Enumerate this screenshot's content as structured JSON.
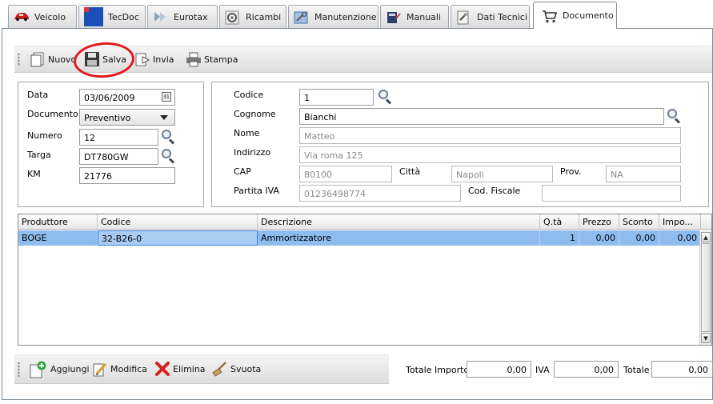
{
  "tabs": [
    {
      "label": "Veicolo",
      "icon": "car-icon"
    },
    {
      "label": "TecDoc",
      "icon": "tecdoc-logo-icon"
    },
    {
      "label": "Eurotax",
      "icon": "eurotax-icon"
    },
    {
      "label": "Ricambi",
      "icon": "spare-parts-icon"
    },
    {
      "label": "Manutenzione",
      "icon": "maintenance-icon"
    },
    {
      "label": "Manuali",
      "icon": "manual-book-icon"
    },
    {
      "label": "Dati Tecnici",
      "icon": "technical-data-icon"
    },
    {
      "label": "Documento",
      "icon": "shopping-cart-icon",
      "active": true
    }
  ],
  "toolbar": {
    "new_label": "Nuovo",
    "save_label": "Salva",
    "send_label": "Invia",
    "print_label": "Stampa"
  },
  "document": {
    "date_label": "Data",
    "date_value": "03/06/2009",
    "doc_label": "Documento",
    "doc_value": "Preventivo",
    "number_label": "Numero",
    "number_value": "12",
    "plate_label": "Targa",
    "plate_value": "DT780GW",
    "km_label": "KM",
    "km_value": "21776"
  },
  "customer": {
    "code_label": "Codice",
    "code_value": "1",
    "surname_label": "Cognome",
    "surname_value": "Bianchi",
    "name_label": "Nome",
    "name_value": "Matteo",
    "address_label": "Indirizzo",
    "address_value": "Via roma 125",
    "cap_label": "CAP",
    "cap_value": "80100",
    "city_label": "Città",
    "city_value": "Napoli",
    "prov_label": "Prov.",
    "prov_value": "NA",
    "vat_label": "Partita IVA",
    "vat_value": "01236498774",
    "tax_label": "Cod. Fiscale",
    "tax_value": ""
  },
  "grid": {
    "columns": [
      "Produttore",
      "Codice",
      "Descrizione",
      "Q.tà",
      "Prezzo",
      "Sconto",
      "Impo..."
    ],
    "rows": [
      {
        "producer": "BOGE",
        "code": "32-B26-0",
        "description": "Ammortizzatore",
        "qty": "1",
        "price": "0,00",
        "discount": "0,00",
        "amount": "0,00"
      }
    ]
  },
  "bottom": {
    "add_label": "Aggiungi",
    "edit_label": "Modifica",
    "delete_label": "Elimina",
    "clear_label": "Svuota",
    "total_amount_label": "Totale Importo",
    "total_amount_value": "0,00",
    "vat_label": "IVA",
    "vat_value": "0,00",
    "total_label": "Totale",
    "total_value": "0,00"
  },
  "colors": {
    "selected_row": "#8fbcef",
    "highlight_circle": "#e01a1a"
  }
}
